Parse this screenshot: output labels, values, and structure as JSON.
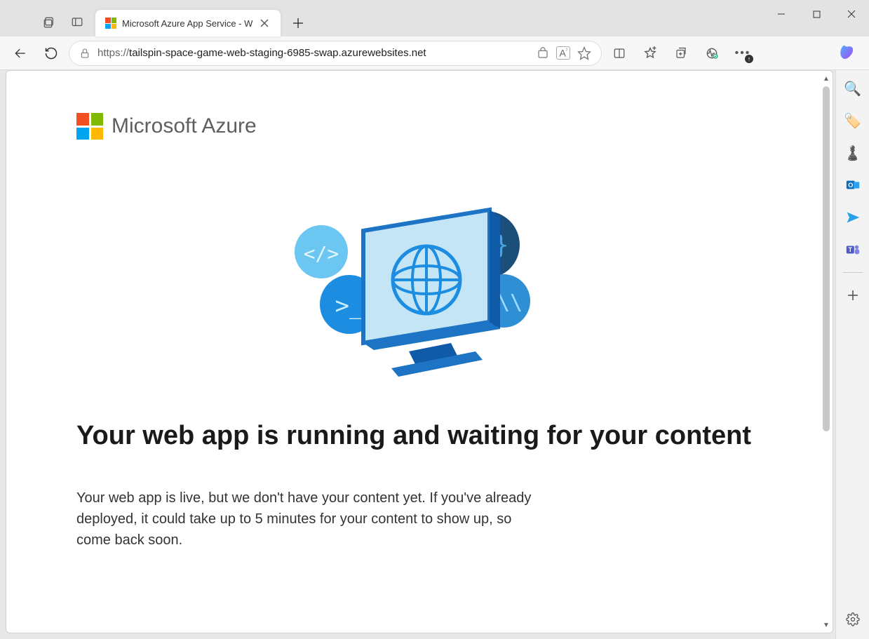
{
  "browser": {
    "tab_title": "Microsoft Azure App Service - W",
    "url_scheme": "https://",
    "url_host": "tailspin-space-game-web-staging-6985-swap.azurewebsites.net",
    "url_path": ""
  },
  "page": {
    "logo_text": "Microsoft Azure",
    "heading": "Your web app is running and waiting for your content",
    "body": "Your web app is live, but we don't have your content yet. If you've already deployed, it could take up to 5 minutes for your content to show up, so come back soon."
  },
  "sidebar": {
    "items": [
      "search",
      "tag",
      "chess",
      "outlook",
      "send",
      "teams"
    ],
    "plus": "+",
    "settings": "settings"
  }
}
